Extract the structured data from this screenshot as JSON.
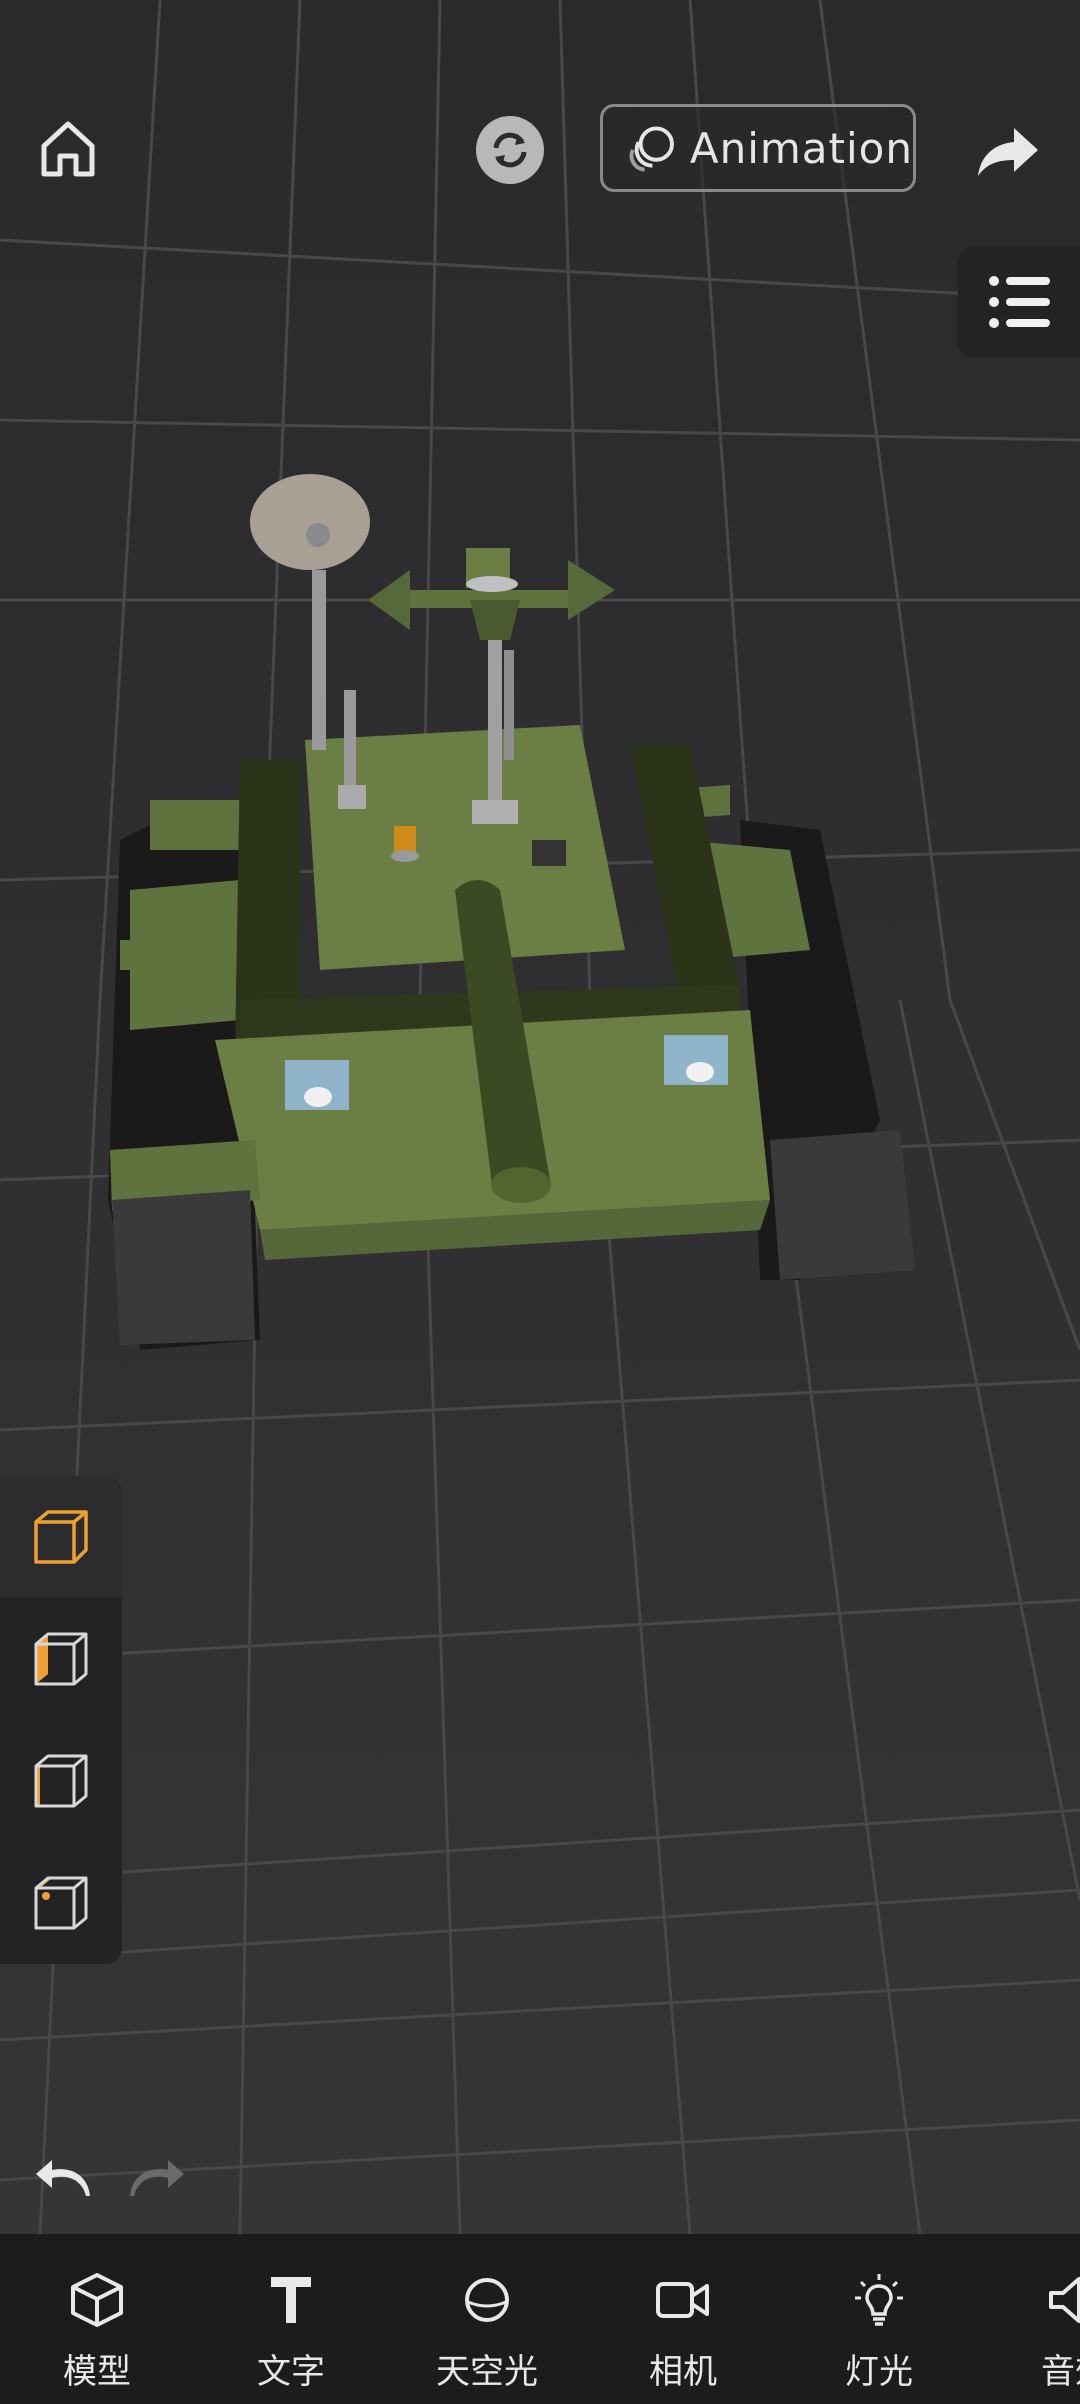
{
  "toolbar": {
    "animation_label": "Animation"
  },
  "bottom_tools": [
    {
      "label": "模型",
      "icon": "cube-icon"
    },
    {
      "label": "文字",
      "icon": "text-icon"
    },
    {
      "label": "天空光",
      "icon": "sky-sphere-icon"
    },
    {
      "label": "相机",
      "icon": "camera-icon"
    },
    {
      "label": "灯光",
      "icon": "light-bulb-icon"
    },
    {
      "label": "音效",
      "icon": "speaker-icon"
    }
  ],
  "view_modes": [
    "perspective-view-icon",
    "front-view-icon",
    "side-view-icon",
    "top-view-icon"
  ],
  "colors": {
    "accent": "#f0a030",
    "tank_green": "#6b7f45",
    "background": "#2c2c2e",
    "bottom_bar": "#1c1c1e"
  }
}
